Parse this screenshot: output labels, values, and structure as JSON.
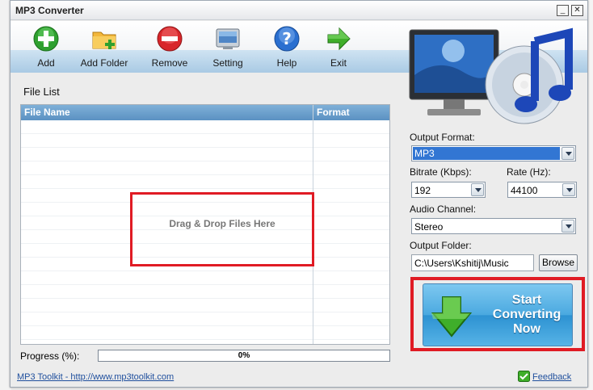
{
  "window": {
    "title": "MP3 Converter",
    "minimize_glyph": "_",
    "close_glyph": "✕"
  },
  "toolbar": {
    "items": [
      {
        "label": "Add",
        "icon": "add-icon"
      },
      {
        "label": "Add Folder",
        "icon": "add-folder-icon"
      },
      {
        "label": "Remove",
        "icon": "remove-icon"
      },
      {
        "label": "Setting",
        "icon": "setting-icon"
      },
      {
        "label": "Help",
        "icon": "help-icon"
      },
      {
        "label": "Exit",
        "icon": "exit-icon"
      }
    ]
  },
  "file_list": {
    "title": "File List",
    "columns": [
      "File Name",
      "Format"
    ],
    "drop_hint": "Drag & Drop Files Here"
  },
  "progress": {
    "label": "Progress (%):",
    "value_text": "0%",
    "value": 0
  },
  "footer": {
    "link_text": "MP3 Toolkit - http://www.mp3toolkit.com",
    "feedback_text": "Feedback"
  },
  "output": {
    "format_label": "Output Format:",
    "format_value": "MP3",
    "bitrate_label": "Bitrate (Kbps):",
    "bitrate_value": "192",
    "rate_label": "Rate (Hz):",
    "rate_value": "44100",
    "channel_label": "Audio Channel:",
    "channel_value": "Stereo",
    "folder_label": "Output Folder:",
    "folder_value": "C:\\Users\\Kshitij\\Music",
    "browse_label": "Browse"
  },
  "start_button": {
    "label": "Start\nConverting\nNow"
  },
  "colors": {
    "highlight_red": "#e01b24",
    "accent_blue": "#3d8ad6",
    "link_blue": "#1f4f9d"
  }
}
